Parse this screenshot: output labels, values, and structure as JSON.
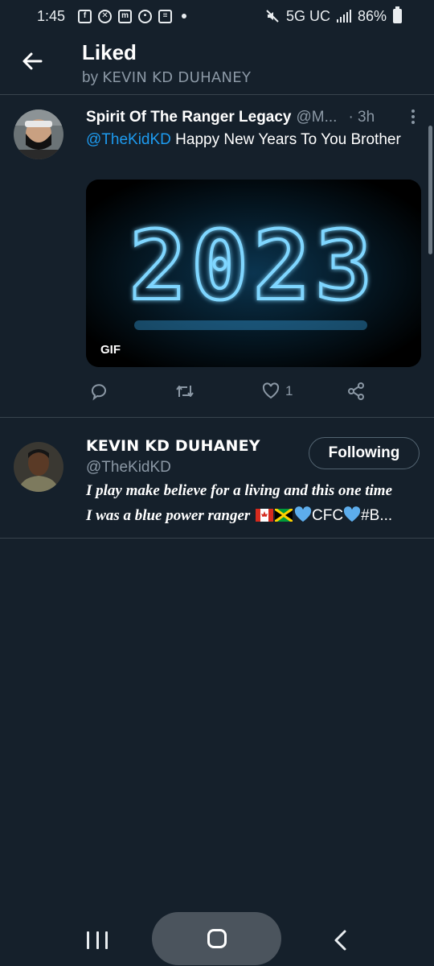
{
  "status_bar": {
    "time": "1:45",
    "network": "5G UC",
    "battery": "86%",
    "notification_icons": [
      "facebook-icon",
      "app-icon",
      "app-icon",
      "cloud-icon",
      "news-icon"
    ]
  },
  "header": {
    "title": "Liked",
    "subtitle_prefix": "by",
    "subtitle_name": "KEVIN KD DUHANEY"
  },
  "tweet": {
    "author_name": "Spirit Of The Ranger Legacy",
    "author_handle": "@M...",
    "time": "· 3h",
    "mention": "@TheKidKD",
    "text": "Happy New Years To You Brother",
    "media_badge": "GIF",
    "gif_text": "2023",
    "actions": {
      "reply_count": "",
      "retweet_count": "",
      "like_count": "1"
    }
  },
  "user": {
    "name": "KEVIN KD DUHANEY",
    "handle": "@TheKidKD",
    "follow_label": "Following",
    "bio_line1": "I play make believe for a living and this one time",
    "bio_line2_text": "I was a blue power ranger",
    "bio_line2_tail": "CFC",
    "bio_line2_end": "#B..."
  },
  "colors": {
    "background": "#15202b",
    "accent": "#1d9bf0",
    "secondary_text": "#8b98a5",
    "divider": "#38444d"
  }
}
